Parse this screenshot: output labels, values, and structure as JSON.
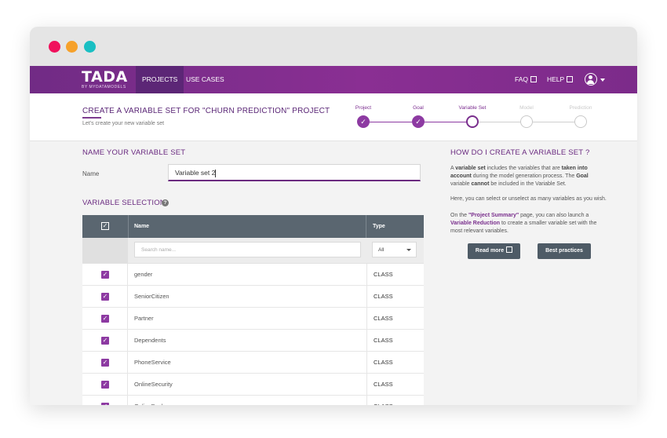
{
  "window_dots": [
    "#f0115c",
    "#f6a12a",
    "#19bfc3"
  ],
  "navbar": {
    "logo": "TADA",
    "logo_sub": "BY MYDATAMODELS",
    "tabs": [
      {
        "label": "PROJECTS",
        "active": true
      },
      {
        "label": "USE CASES",
        "active": false
      }
    ],
    "faq": "FAQ",
    "help": "HELP",
    "accent": "#7c2b8a"
  },
  "header": {
    "title": "CREATE A VARIABLE SET FOR \"CHURN PREDICTION\" PROJECT",
    "subtitle": "Let's create your new variable set"
  },
  "steps": [
    {
      "label": "Project",
      "state": "done"
    },
    {
      "label": "Goal",
      "state": "done"
    },
    {
      "label": "Variable Set",
      "state": "current"
    },
    {
      "label": "Model",
      "state": "pending"
    },
    {
      "label": "Prediction",
      "state": "pending"
    }
  ],
  "name_section": {
    "title": "NAME YOUR VARIABLE SET",
    "label": "Name",
    "value": "Variable set 2"
  },
  "variable_section": {
    "title": "VARIABLE SELECTION",
    "help_icon": "?"
  },
  "table": {
    "headers": {
      "check": "✓",
      "name": "Name",
      "type": "Type"
    },
    "search_placeholder": "Search name...",
    "type_filter": "All",
    "rows": [
      {
        "name": "gender",
        "type": "CLASS",
        "checked": true
      },
      {
        "name": "SeniorCitizen",
        "type": "CLASS",
        "checked": true
      },
      {
        "name": "Partner",
        "type": "CLASS",
        "checked": true
      },
      {
        "name": "Dependents",
        "type": "CLASS",
        "checked": true
      },
      {
        "name": "PhoneService",
        "type": "CLASS",
        "checked": true
      },
      {
        "name": "OnlineSecurity",
        "type": "CLASS",
        "checked": true
      },
      {
        "name": "OnlineBackup",
        "type": "CLASS",
        "checked": true
      }
    ]
  },
  "help_panel": {
    "title": "HOW DO I CREATE A VARIABLE SET ?",
    "p1": {
      "a": "A ",
      "b": "variable set",
      "c": " includes the variables that are ",
      "d": "taken into account",
      "e": " during the model generation process. The ",
      "f": "Goal",
      "g": " variable ",
      "h": "cannot",
      "i": " be included in the Variable Set."
    },
    "p2": "Here, you can select or unselect as many variables as you wish.",
    "p3": {
      "a": "On the ",
      "b": "\"Project Summary\"",
      "c": " page, you can also launch a ",
      "d": "Variable Reduction",
      "e": " to create a smaller variable set with the most relevant variables."
    },
    "read_more": "Read more",
    "best_practices": "Best practices"
  }
}
